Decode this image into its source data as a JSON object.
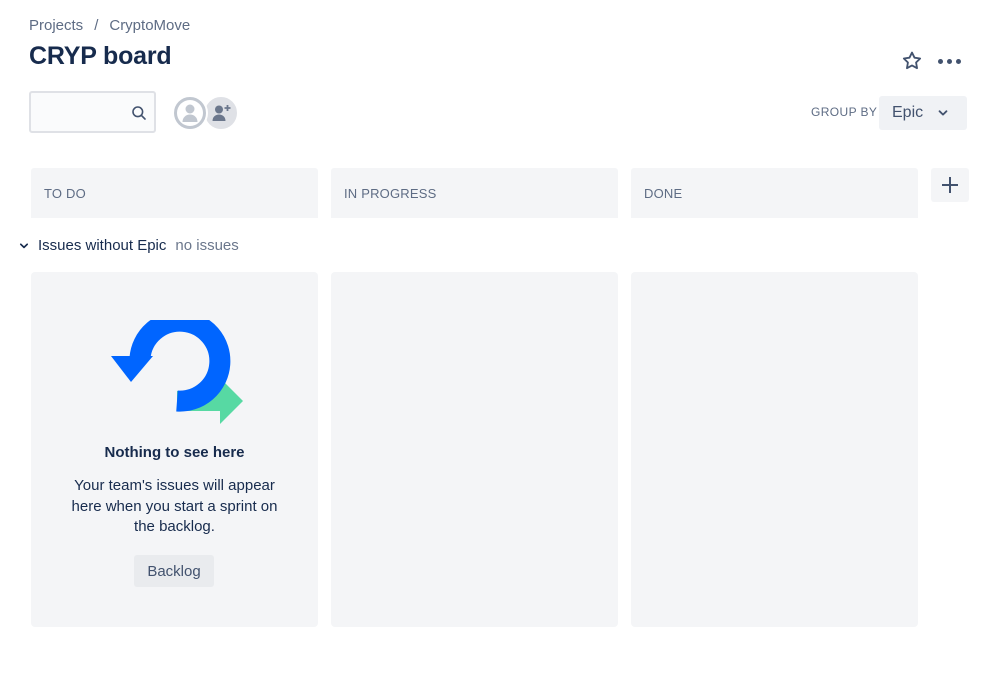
{
  "breadcrumb": {
    "items": [
      "Projects",
      "CryptoMove"
    ],
    "separator": "/"
  },
  "page": {
    "title": "CRYP board"
  },
  "toolbar": {
    "search_placeholder": "",
    "group_by_label": "GROUP BY",
    "group_by_value": "Epic"
  },
  "columns": [
    {
      "label": "TO DO"
    },
    {
      "label": "IN PROGRESS"
    },
    {
      "label": "DONE"
    }
  ],
  "swimlane": {
    "title": "Issues without Epic",
    "count_label": "no issues"
  },
  "empty_state": {
    "title": "Nothing to see here",
    "description": "Your team's issues will appear here when you start a sprint on the backlog.",
    "button_label": "Backlog"
  },
  "icons": {
    "star": "star-icon",
    "more": "more-icon",
    "search": "search-icon",
    "user": "user-avatar-icon",
    "add_user": "add-user-icon",
    "add_column": "plus-icon",
    "chevron": "chevron-down-icon"
  },
  "colors": {
    "primary_text": "#172b4d",
    "secondary_text": "#5e6c84",
    "column_bg": "#f4f5f7",
    "illustration_blue": "#0065ff",
    "illustration_green": "#57d9a3"
  }
}
